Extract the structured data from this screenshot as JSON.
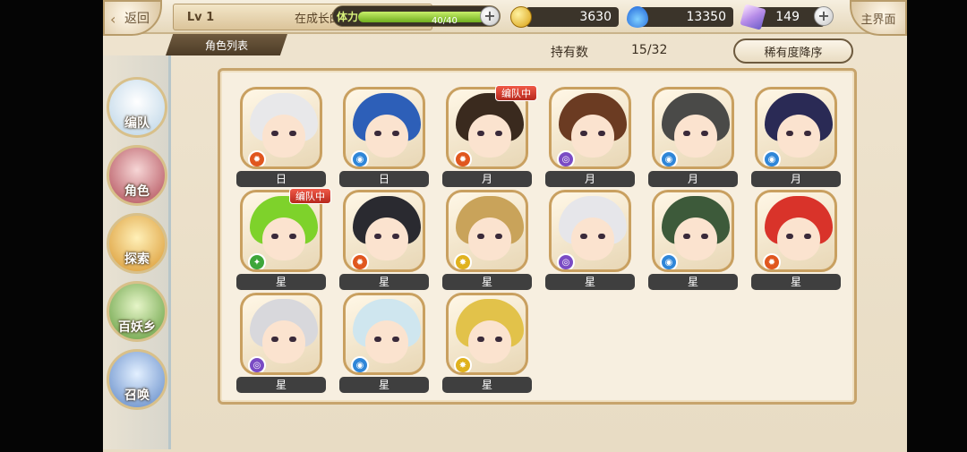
{
  "topbar": {
    "back_label": "返回",
    "level": "Lv 1",
    "title": "在成长的路上",
    "stamina_label": "体力",
    "stamina_text": "40/40",
    "stamina_fraction": 1.0,
    "gold": "3630",
    "soul": "13350",
    "crystal": "149",
    "home_label": "主界面"
  },
  "header": {
    "tab_label": "角色列表",
    "owned_label": "持有数",
    "owned_value": "15/32",
    "sort_label": "稀有度降序"
  },
  "sidebar": {
    "items": [
      {
        "label": "编队",
        "icon": "team-icon"
      },
      {
        "label": "角色",
        "icon": "character-icon"
      },
      {
        "label": "探索",
        "icon": "explore-icon"
      },
      {
        "label": "百妖乡",
        "icon": "village-icon"
      },
      {
        "label": "召唤",
        "icon": "summon-icon"
      }
    ]
  },
  "colors": {
    "hair": [
      "#e8e8ea",
      "#2d5fb8",
      "#3a2a1e",
      "#6b3b22",
      "#4a4a48",
      "#2a2a55",
      "#7ed22b",
      "#2a2a30",
      "#c9a35a",
      "#e6e6ea",
      "#3d5a3a",
      "#d9332a",
      "#d8d8dc",
      "#cfe6ef",
      "#e2c24a"
    ],
    "badge_team": "#c8362a"
  },
  "cards": [
    {
      "name": "日",
      "attr": "fire",
      "badge": ""
    },
    {
      "name": "日",
      "attr": "water",
      "badge": ""
    },
    {
      "name": "月",
      "attr": "fire",
      "badge": "编队中"
    },
    {
      "name": "月",
      "attr": "dark",
      "badge": ""
    },
    {
      "name": "月",
      "attr": "water",
      "badge": ""
    },
    {
      "name": "月",
      "attr": "water",
      "badge": ""
    },
    {
      "name": "星",
      "attr": "wind",
      "badge": "编队中"
    },
    {
      "name": "星",
      "attr": "fire",
      "badge": ""
    },
    {
      "name": "星",
      "attr": "light",
      "badge": ""
    },
    {
      "name": "星",
      "attr": "dark",
      "badge": ""
    },
    {
      "name": "星",
      "attr": "water",
      "badge": ""
    },
    {
      "name": "星",
      "attr": "fire",
      "badge": ""
    },
    {
      "name": "星",
      "attr": "dark",
      "badge": ""
    },
    {
      "name": "星",
      "attr": "water",
      "badge": ""
    },
    {
      "name": "星",
      "attr": "light",
      "badge": ""
    }
  ]
}
